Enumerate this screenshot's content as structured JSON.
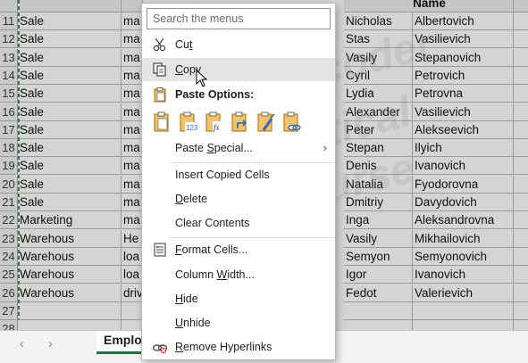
{
  "sheet": {
    "header_text": "Name",
    "rows": [
      {
        "num": "11",
        "a": "Sale",
        "b": "ma",
        "d": "Nicholas",
        "e": "Albertovich"
      },
      {
        "num": "12",
        "a": "Sale",
        "b": "ma",
        "d": "Stas",
        "e": "Vasilievich"
      },
      {
        "num": "13",
        "a": "Sale",
        "b": "ma",
        "d": "Vasily",
        "e": "Stepanovich"
      },
      {
        "num": "14",
        "a": "Sale",
        "b": "ma",
        "d": "Cyril",
        "e": "Petrovich"
      },
      {
        "num": "15",
        "a": "Sale",
        "b": "ma",
        "d": "Lydia",
        "e": "Petrovna"
      },
      {
        "num": "16",
        "a": "Sale",
        "b": "ma",
        "d": "Alexander",
        "e": "Vasilievich"
      },
      {
        "num": "17",
        "a": "Sale",
        "b": "ma",
        "d": "Peter",
        "e": "Alekseevich"
      },
      {
        "num": "18",
        "a": "Sale",
        "b": "ma",
        "d": "Stepan",
        "e": "Ilyich"
      },
      {
        "num": "19",
        "a": "Sale",
        "b": "ma",
        "d": "Denis",
        "e": "Ivanovich"
      },
      {
        "num": "20",
        "a": "Sale",
        "b": "ma",
        "d": "Natalia",
        "e": "Fyodorovna"
      },
      {
        "num": "21",
        "a": "Sale",
        "b": "ma",
        "d": "Dmitriy",
        "e": "Davydovich"
      },
      {
        "num": "22",
        "a": "Marketing",
        "b": "ma",
        "d": "Inga",
        "e": "Aleksandrovna"
      },
      {
        "num": "23",
        "a": "Warehous",
        "b": "He",
        "d": "Vasily",
        "e": "Mikhailovich"
      },
      {
        "num": "24",
        "a": "Warehous",
        "b": "loa",
        "d": "Semyon",
        "e": "Semyonovich"
      },
      {
        "num": "25",
        "a": "Warehous",
        "b": "loa",
        "d": "Igor",
        "e": "Ivanovich"
      },
      {
        "num": "26",
        "a": "Warehous",
        "b": "driv",
        "d": "Fedot",
        "e": "Valerievich"
      },
      {
        "num": "27",
        "a": "",
        "b": "",
        "d": "",
        "e": ""
      },
      {
        "num": "28",
        "a": "",
        "b": "",
        "d": "",
        "e": ""
      }
    ]
  },
  "tabbar": {
    "prev_arrow": "‹",
    "next_arrow": "›",
    "sheet_tab": "Employ"
  },
  "watermark": {
    "line1": "Skorcoder",
    "line2": "Vertical",
    "line3": "Course"
  },
  "context_menu": {
    "search_placeholder": "Search the menus",
    "cut": "Cut",
    "copy": "Copy",
    "paste_options": "Paste Options:",
    "paste_special": "Paste Special...",
    "insert_copied_cells": "Insert Copied Cells",
    "delete": "Delete",
    "clear_contents": "Clear Contents",
    "format_cells": "Format Cells...",
    "column_width": "Column Width...",
    "hide": "Hide",
    "unhide": "Unhide",
    "remove_hyperlinks": "Remove Hyperlinks",
    "submenu_arrow": "›",
    "paste_icons": [
      "paste-icon",
      "paste-values-icon",
      "paste-formulas-icon",
      "paste-transpose-icon",
      "paste-formatting-icon",
      "paste-link-icon"
    ],
    "paste_icon_texts": [
      "123",
      "fx"
    ]
  },
  "colors": {
    "accent_green": "#217346",
    "icon_orange": "#d68a1f",
    "icon_blue": "#2f6db5",
    "highlight": "#e5e5e5"
  }
}
